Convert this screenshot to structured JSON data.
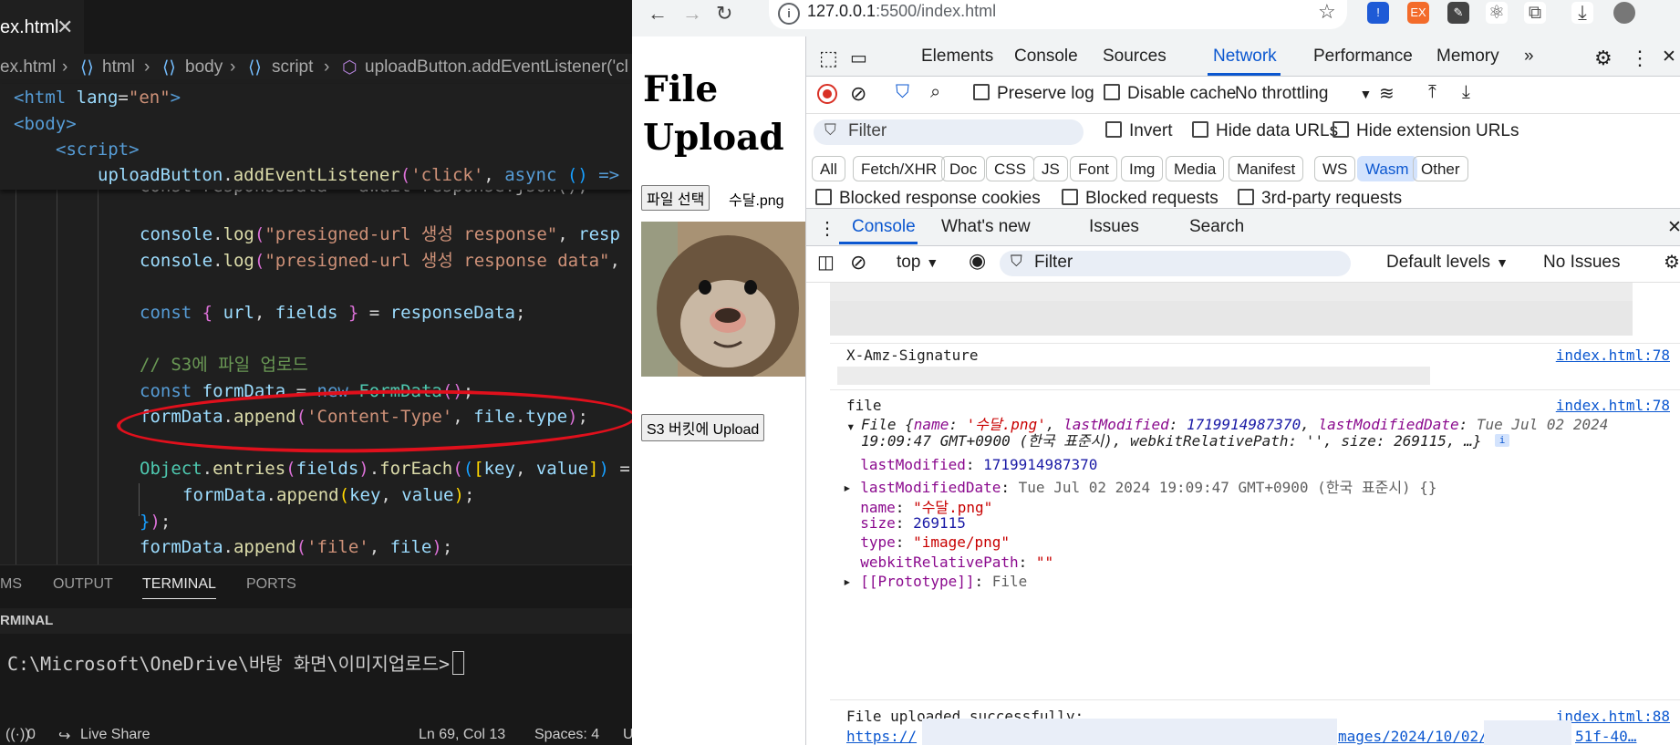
{
  "editor": {
    "tab_label": "ex.html",
    "tab_close": "✕",
    "breadcrumb": [
      "ex.html",
      "html",
      "body",
      "script",
      "uploadButton.addEventListener('cl"
    ],
    "sticky_lines": [
      "<html lang=\"en\">",
      "<body>",
      "<script>",
      "uploadButton.addEventListener('click', async () =>"
    ],
    "code_lines": [
      "const responseData = await response.json();",
      "",
      "console.log(\"presigned-url 생성 response\", resp",
      "console.log(\"presigned-url 생성 response data\",",
      "",
      "const { url, fields } = responseData;",
      "",
      "// S3에 파일 업로드",
      "const formData = new FormData();",
      "formData.append('Content-Type', file.type);",
      "",
      "Object.entries(fields).forEach(([key, value]) =",
      "formData.append(key, value);",
      "});",
      "formData.append('file', file);"
    ]
  },
  "panel": {
    "tabs": [
      "MS",
      "OUTPUT",
      "TERMINAL",
      "PORTS"
    ],
    "header": "RMINAL",
    "prompt": "C:\\Microsoft\\OneDrive\\바탕 화면\\이미지업로드>"
  },
  "statusbar": {
    "ports": "0",
    "live_share": "Live Share",
    "position": "Ln 69, Col 13",
    "spaces": "Spaces: 4",
    "encoding": "U"
  },
  "browser": {
    "url": "127.0.0.1:5500/index.html",
    "url_host": "127.0.0.1",
    "url_rest": ":5500/index.html"
  },
  "page": {
    "title": "File Upload",
    "choose_file_button": "파일 선택",
    "file_name": "수달.png",
    "upload_button": "S3 버킷에 Upload"
  },
  "devtools": {
    "tabs": [
      "Elements",
      "Console",
      "Sources",
      "Network",
      "Performance",
      "Memory"
    ],
    "active_tab": "Network",
    "preserve_log": "Preserve log",
    "disable_cache": "Disable cache",
    "throttling": "No throttling",
    "filter_placeholder": "Filter",
    "invert": "Invert",
    "hide_data_urls": "Hide data URLs",
    "hide_extension_urls": "Hide extension URLs",
    "type_filters": [
      "All",
      "Fetch/XHR",
      "Doc",
      "CSS",
      "JS",
      "Font",
      "Img",
      "Media",
      "Manifest",
      "WS",
      "Wasm",
      "Other"
    ],
    "active_type": "Wasm",
    "blocked_response_cookies": "Blocked response cookies",
    "blocked_requests": "Blocked requests",
    "third_party_requests": "3rd-party requests",
    "drawer_tabs": [
      "Console",
      "What's new",
      "Issues",
      "Search"
    ],
    "context": "top",
    "console_filter": "Filter",
    "levels": "Default levels",
    "issues": "No Issues"
  },
  "console": {
    "signature_label": "X-Amz-Signature",
    "signature_src": "index.html:78",
    "file_label": "file",
    "file_src": "index.html:78",
    "file_summary_prefix": "File {",
    "file_summary_line1": [
      {
        "k": "name",
        "v": "'수달.png'",
        "t": "s"
      },
      {
        "k": "lastModified",
        "v": "1719914987370",
        "t": "n"
      },
      {
        "k": "lastModifiedDate",
        "v": "Tue Jul 02 2024",
        "t": "p"
      }
    ],
    "file_summary_line2": "19:09:47 GMT+0900 (한국 표준시), webkitRelativePath: '', size: 269115, …}",
    "props": [
      {
        "k": "lastModified",
        "v": "1719914987370",
        "t": "n",
        "exp": false
      },
      {
        "k": "lastModifiedDate",
        "v": "Tue Jul 02 2024 19:09:47 GMT+0900 (한국 표준시) {}",
        "t": "p",
        "exp": true
      },
      {
        "k": "name",
        "v": "\"수달.png\"",
        "t": "s",
        "exp": false
      },
      {
        "k": "size",
        "v": "269115",
        "t": "n",
        "exp": false
      },
      {
        "k": "type",
        "v": "\"image/png\"",
        "t": "s",
        "exp": false
      },
      {
        "k": "webkitRelativePath",
        "v": "\"\"",
        "t": "s",
        "exp": false
      },
      {
        "k": "[[Prototype]]",
        "v": "File",
        "t": "p",
        "exp": true
      }
    ],
    "uploaded_msg": "File uploaded successfully:",
    "uploaded_src": "index.html:88",
    "uploaded_url_start": "https://",
    "uploaded_url_mid": "mages/2024/10/02/",
    "uploaded_url_end": "51f-40…"
  }
}
